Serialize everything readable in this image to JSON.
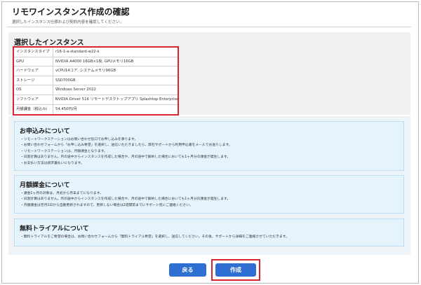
{
  "header": {
    "title": "リモワインスタンス作成の確認",
    "subtitle": "選択したインスタンス仕様および契約内容を確認してください。"
  },
  "selected": {
    "heading": "選択したインスタンス",
    "rows": [
      {
        "label": "インスタンスタイプ",
        "value": "r16-1-a-standard-w22-k"
      },
      {
        "label": "GPU",
        "value": "NVIDIA A4000 16GB×1枚, GPUメモリ16GB"
      },
      {
        "label": "ハードウェア",
        "value": "vCPU14コア, システムメモリ96GB"
      },
      {
        "label": "ストレージ",
        "value": "SSD700GB"
      },
      {
        "label": "OS",
        "value": "Windows Server 2022"
      },
      {
        "label": "ソフトウェア",
        "value": "NVIDIA Driver 516 リモートデスクトップアプリ Splashtop Enterprise"
      },
      {
        "label": "月額課金（税込み）",
        "value": "54,450円/月"
      }
    ]
  },
  "sections": {
    "apply": {
      "heading": "お申込みについて",
      "lines": [
        "・リモートワークステーションはお問い合わせ窓口でお申し込みを承ります。",
        "・お問い合わせフォームから「お申し込み希望」を選択し、送信いただきましたら、弊社サポートから利用申込書をメールでお送りします。",
        "・リモートワークステーションは、月額課金となります。",
        "・日割計算はありません。月の途中からインスタンスを作成した場合や、月の途中で解約した場合においても1ヶ月分の課金が発生します。",
        "・お支払い方法は請求書払いになります。"
      ]
    },
    "monthly": {
      "heading": "月額課金について",
      "lines": [
        "・課金1ヶ月の対象は、月初から月末までになります。",
        "・日割計算はありません。月の途中からインスタンスを作成した場合や、月の途中で解約した場合においても1ヶ月分の課金が発生します。",
        "・月額課金は翌月1日から自動更新されますので、更新しない場合は2週間前までにサポート宛にご連絡ください。"
      ]
    },
    "trial": {
      "heading": "無料トライアルについて",
      "lines": [
        "・無料トライアルをご希望の場合は、お問い合わせフォームから「無料トライアル希望」を選択し、送信してください。その後、サポートから詳細をご連絡させていただきます。"
      ]
    }
  },
  "buttons": {
    "back": "戻る",
    "create": "作成"
  },
  "colors": {
    "primary": "#2f6fd1",
    "highlight": "#d7262f",
    "info_bg": "#e5f3fd"
  }
}
